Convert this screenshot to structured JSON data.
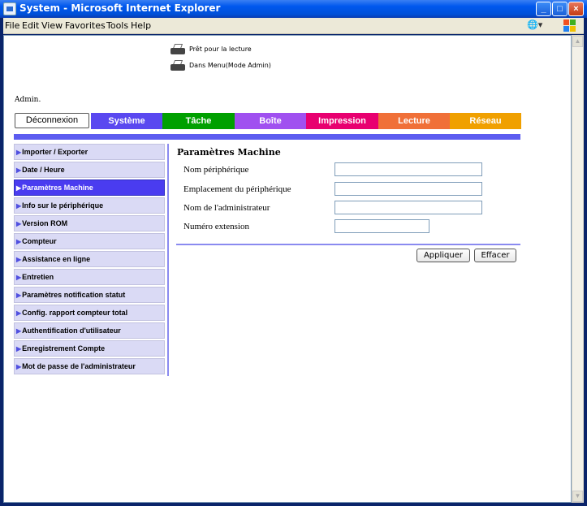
{
  "window": {
    "title": "System - Microsoft Internet Explorer"
  },
  "menubar": {
    "items": [
      "File",
      "Edit",
      "View",
      "Favorites",
      "Tools",
      "Help"
    ]
  },
  "status": {
    "line1": "Prêt pour la lecture",
    "line2": "Dans Menu(Mode Admin)"
  },
  "admin_label": "Admin.",
  "tabs": [
    {
      "label": "Déconnexion",
      "color": "#ffffff"
    },
    {
      "label": "Système",
      "color": "#5a48f0"
    },
    {
      "label": "Tâche",
      "color": "#00a000"
    },
    {
      "label": "Boîte",
      "color": "#a050f0"
    },
    {
      "label": "Impression",
      "color": "#e80070"
    },
    {
      "label": "Lecture",
      "color": "#f07038"
    },
    {
      "label": "Réseau",
      "color": "#f0a000"
    }
  ],
  "sidebar": {
    "items": [
      {
        "label": "Importer / Exporter",
        "active": false
      },
      {
        "label": "Date / Heure",
        "active": false
      },
      {
        "label": "Paramètres Machine",
        "active": true
      },
      {
        "label": "Info sur le périphérique",
        "active": false
      },
      {
        "label": "Version ROM",
        "active": false
      },
      {
        "label": "Compteur",
        "active": false
      },
      {
        "label": "Assistance en ligne",
        "active": false
      },
      {
        "label": "Entretien",
        "active": false
      },
      {
        "label": "Paramètres notification statut",
        "active": false
      },
      {
        "label": "Config. rapport compteur total",
        "active": false
      },
      {
        "label": "Authentification d'utilisateur",
        "active": false
      },
      {
        "label": "Enregistrement Compte",
        "active": false
      },
      {
        "label": "Mot de passe de l'administrateur",
        "active": false
      }
    ]
  },
  "form": {
    "title": "Paramètres Machine",
    "fields": [
      {
        "label": "Nom périphérique",
        "value": ""
      },
      {
        "label": "Emplacement du périphérique",
        "value": ""
      },
      {
        "label": "Nom de l'administrateur",
        "value": ""
      },
      {
        "label": "Numéro extension",
        "value": ""
      }
    ],
    "apply_label": "Appliquer",
    "clear_label": "Effacer"
  }
}
